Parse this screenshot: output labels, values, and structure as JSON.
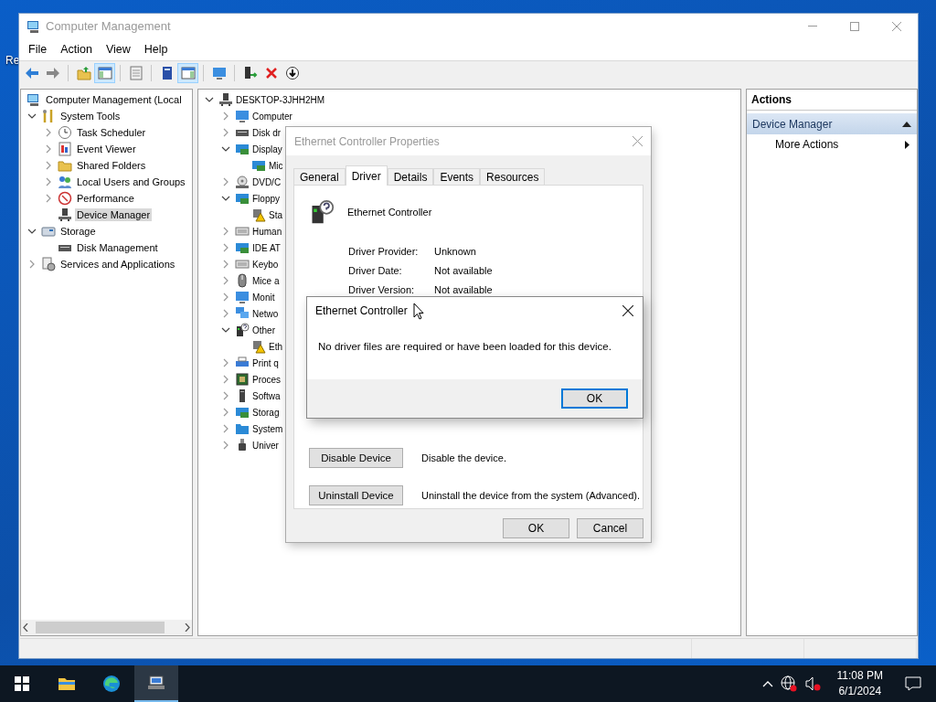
{
  "desktop": {
    "icon_label": "Re"
  },
  "window": {
    "title": "Computer Management",
    "menu": [
      "File",
      "Action",
      "View",
      "Help"
    ],
    "toolbar": [
      [
        {
          "kind": "back",
          "on": false
        },
        {
          "kind": "forward",
          "on": false
        }
      ],
      [
        {
          "kind": "up",
          "on": false
        },
        {
          "kind": "console-tree",
          "on": true
        }
      ],
      [
        {
          "kind": "export",
          "on": false
        }
      ],
      [
        {
          "kind": "help",
          "on": false
        },
        {
          "kind": "action-pane",
          "on": true
        }
      ],
      [
        {
          "kind": "connect",
          "on": false
        }
      ],
      [
        {
          "kind": "scan",
          "on": false
        },
        {
          "kind": "uninstall",
          "on": false
        },
        {
          "kind": "update",
          "on": false
        }
      ]
    ],
    "console_tree": [
      {
        "label": "Computer Management (Local",
        "kind": "mgmt",
        "has_expander": false,
        "selected": false,
        "children": [
          {
            "label": "System Tools",
            "kind": "tools",
            "has_expander": true,
            "expanded": true,
            "selected": false,
            "children": [
              {
                "label": "Task Scheduler",
                "kind": "clock",
                "has_expander": true,
                "expanded": false,
                "selected": false
              },
              {
                "label": "Event Viewer",
                "kind": "log",
                "has_expander": true,
                "expanded": false,
                "selected": false
              },
              {
                "label": "Shared Folders",
                "kind": "share",
                "has_expander": true,
                "expanded": false,
                "selected": false
              },
              {
                "label": "Local Users and Groups",
                "kind": "users",
                "has_expander": true,
                "expanded": false,
                "selected": false
              },
              {
                "label": "Performance",
                "kind": "gauge",
                "has_expander": true,
                "expanded": false,
                "selected": false
              },
              {
                "label": "Device Manager",
                "kind": "device",
                "has_expander": false,
                "selected": true
              }
            ]
          },
          {
            "label": "Storage",
            "kind": "storage",
            "has_expander": true,
            "expanded": true,
            "selected": false,
            "children": [
              {
                "label": "Disk Management",
                "kind": "disk",
                "has_expander": false,
                "selected": false
              }
            ]
          },
          {
            "label": "Services and Applications",
            "kind": "services",
            "has_expander": true,
            "expanded": false,
            "selected": false
          }
        ]
      }
    ],
    "device_tree": [
      {
        "label": "DESKTOP-3JHH2HM",
        "kind": "device",
        "has_expander": true,
        "expanded": true,
        "selected": false,
        "children": [
          {
            "label": "Computer",
            "kind": "monitor",
            "has_expander": true,
            "expanded": false,
            "selected": false
          },
          {
            "label": "Disk dr",
            "kind": "disk",
            "has_expander": true,
            "expanded": false,
            "selected": false
          },
          {
            "label": "Display",
            "kind": "card",
            "has_expander": true,
            "expanded": true,
            "selected": false,
            "children": [
              {
                "label": "Mic",
                "kind": "card",
                "has_expander": false,
                "selected": false
              }
            ]
          },
          {
            "label": "DVD/C",
            "kind": "disc",
            "has_expander": true,
            "expanded": false,
            "selected": false
          },
          {
            "label": "Floppy",
            "kind": "card",
            "has_expander": true,
            "expanded": true,
            "selected": false,
            "children": [
              {
                "label": "Sta",
                "kind": "warning",
                "has_expander": false,
                "selected": false
              }
            ]
          },
          {
            "label": "Human",
            "kind": "keyboard",
            "has_expander": true,
            "expanded": false,
            "selected": false
          },
          {
            "label": "IDE AT",
            "kind": "card",
            "has_expander": true,
            "expanded": false,
            "selected": false
          },
          {
            "label": "Keybo",
            "kind": "keyboard",
            "has_expander": true,
            "expanded": false,
            "selected": false
          },
          {
            "label": "Mice a",
            "kind": "mouse",
            "has_expander": true,
            "expanded": false,
            "selected": false
          },
          {
            "label": "Monit",
            "kind": "monitor",
            "has_expander": true,
            "expanded": false,
            "selected": false
          },
          {
            "label": "Netwo",
            "kind": "network",
            "has_expander": true,
            "expanded": false,
            "selected": false
          },
          {
            "label": "Other",
            "kind": "unknown",
            "has_expander": true,
            "expanded": true,
            "selected": false,
            "children": [
              {
                "label": "Eth",
                "kind": "warning",
                "has_expander": false,
                "selected": false
              }
            ]
          },
          {
            "label": "Print q",
            "kind": "printer",
            "has_expander": true,
            "expanded": false,
            "selected": false
          },
          {
            "label": "Proces",
            "kind": "chip",
            "has_expander": true,
            "expanded": false,
            "selected": false
          },
          {
            "label": "Softwa",
            "kind": "tower",
            "has_expander": true,
            "expanded": false,
            "selected": false
          },
          {
            "label": "Storag",
            "kind": "card",
            "has_expander": true,
            "expanded": false,
            "selected": false
          },
          {
            "label": "System",
            "kind": "sysfolder",
            "has_expander": true,
            "expanded": false,
            "selected": false
          },
          {
            "label": "Univer",
            "kind": "usb",
            "has_expander": true,
            "expanded": false,
            "selected": false
          }
        ]
      }
    ],
    "actions_pane": {
      "header": "Actions",
      "sections": [
        {
          "title": "Device Manager",
          "expanded": true,
          "items": [
            {
              "label": "More Actions",
              "submenu": true
            }
          ]
        }
      ]
    }
  },
  "properties_dialog": {
    "title": "Ethernet Controller Properties",
    "tabs": [
      {
        "label": "General",
        "selected": false
      },
      {
        "label": "Driver",
        "selected": true
      },
      {
        "label": "Details",
        "selected": false
      },
      {
        "label": "Events",
        "selected": false
      },
      {
        "label": "Resources",
        "selected": false
      }
    ],
    "device_name": "Ethernet Controller",
    "fields": [
      {
        "label": "Driver Provider:",
        "value": "Unknown"
      },
      {
        "label": "Driver Date:",
        "value": "Not available"
      },
      {
        "label": "Driver Version:",
        "value": "Not available"
      }
    ],
    "actions": [
      {
        "button": "Disable Device",
        "description": "Disable the device."
      },
      {
        "button": "Uninstall Device",
        "description": "Uninstall the device from the system (Advanced)."
      }
    ],
    "buttons": [
      "OK",
      "Cancel"
    ]
  },
  "message_box": {
    "title": "Ethernet Controller",
    "message": "No driver files are required or have been loaded for this device.",
    "buttons": [
      {
        "label": "OK",
        "default": true
      }
    ]
  },
  "taskbar": {
    "apps": [
      {
        "kind": "start",
        "active": false
      },
      {
        "kind": "explorer",
        "active": false
      },
      {
        "kind": "browser",
        "active": false
      },
      {
        "kind": "computer-management",
        "active": true
      }
    ],
    "tray": {
      "network_connected": false,
      "muted": true,
      "time": "11:08 PM",
      "date": "6/1/2024"
    }
  }
}
